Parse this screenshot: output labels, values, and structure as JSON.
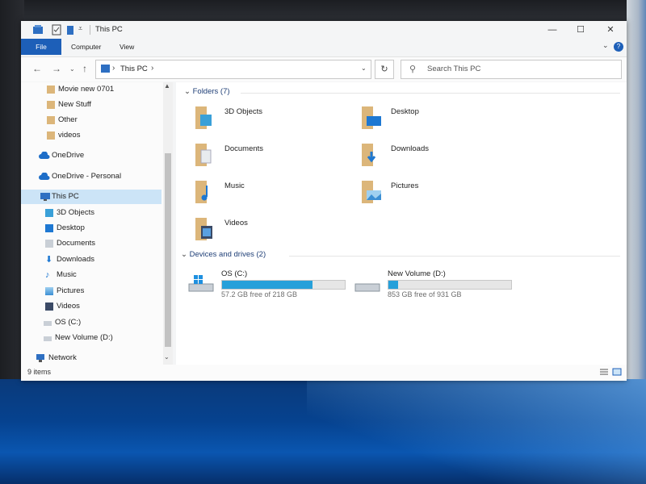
{
  "window": {
    "title": "This PC"
  },
  "ribbon": {
    "tabs": [
      "File",
      "Computer",
      "View"
    ]
  },
  "navigation": {
    "address_path": "This PC",
    "search_placeholder": "Search This PC"
  },
  "sidebar": {
    "items": [
      {
        "label": "Movie new 0701",
        "icon": "folder-icon"
      },
      {
        "label": "New Stuff",
        "icon": "folder-icon"
      },
      {
        "label": "Other",
        "icon": "folder-icon"
      },
      {
        "label": "videos",
        "icon": "folder-icon"
      },
      {
        "label": "OneDrive",
        "icon": "cloud-icon"
      },
      {
        "label": "OneDrive - Personal",
        "icon": "cloud-icon"
      },
      {
        "label": "This PC",
        "icon": "computer-icon",
        "selected": true
      },
      {
        "label": "3D Objects",
        "icon": "3d-objects-icon"
      },
      {
        "label": "Desktop",
        "icon": "desktop-icon"
      },
      {
        "label": "Documents",
        "icon": "documents-icon"
      },
      {
        "label": "Downloads",
        "icon": "downloads-icon"
      },
      {
        "label": "Music",
        "icon": "music-icon"
      },
      {
        "label": "Pictures",
        "icon": "pictures-icon"
      },
      {
        "label": "Videos",
        "icon": "videos-icon"
      },
      {
        "label": "OS (C:)",
        "icon": "drive-icon"
      },
      {
        "label": "New Volume (D:)",
        "icon": "drive-icon"
      },
      {
        "label": "Network",
        "icon": "network-icon"
      }
    ]
  },
  "main": {
    "folders_header": "Folders (7)",
    "folders": [
      {
        "label": "3D Objects",
        "icon": "3d-objects-folder-icon"
      },
      {
        "label": "Desktop",
        "icon": "desktop-folder-icon"
      },
      {
        "label": "Documents",
        "icon": "documents-folder-icon"
      },
      {
        "label": "Downloads",
        "icon": "downloads-folder-icon"
      },
      {
        "label": "Music",
        "icon": "music-folder-icon"
      },
      {
        "label": "Pictures",
        "icon": "pictures-folder-icon"
      },
      {
        "label": "Videos",
        "icon": "videos-folder-icon"
      }
    ],
    "drives_header": "Devices and drives (2)",
    "drives": [
      {
        "name": "OS (C:)",
        "free_text": "57.2 GB free of 218 GB",
        "used_fraction": 0.74,
        "icon": "windows-drive-icon"
      },
      {
        "name": "New Volume (D:)",
        "free_text": "853 GB free of 931 GB",
        "used_fraction": 0.08,
        "icon": "drive-icon"
      }
    ]
  },
  "status": {
    "item_count": "9 items"
  },
  "colors": {
    "accent": "#1d5fb8",
    "selection": "#cce4f7",
    "drive_fill": "#26a0da",
    "folder": "#dcb67a"
  }
}
